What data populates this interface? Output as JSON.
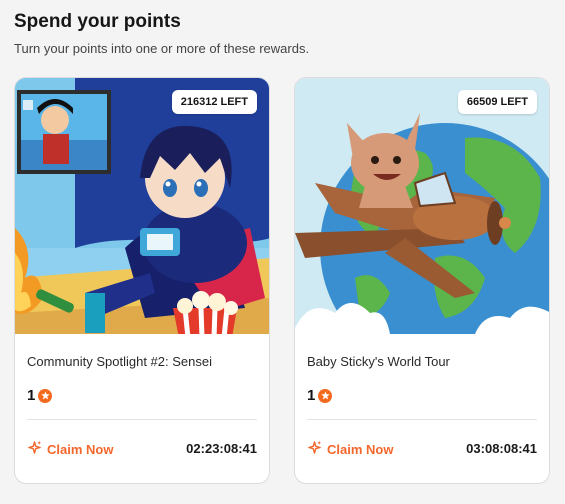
{
  "header": {
    "title": "Spend your points",
    "subtitle": "Turn your points into one or more of these rewards."
  },
  "rewards": [
    {
      "left_badge": "216312 LEFT",
      "title": "Community Spotlight #2: Sensei",
      "price": "1",
      "claim_label": "Claim Now",
      "timer": "02:23:08:41",
      "image_icon": "anime-character-image"
    },
    {
      "left_badge": "66509 LEFT",
      "title": "Baby Sticky's World Tour",
      "price": "1",
      "claim_label": "Claim Now",
      "timer": "03:08:08:41",
      "image_icon": "airplane-globe-image"
    }
  ],
  "colors": {
    "accent": "#f2672b",
    "background": "#f4f4f5",
    "card": "#ffffff"
  }
}
